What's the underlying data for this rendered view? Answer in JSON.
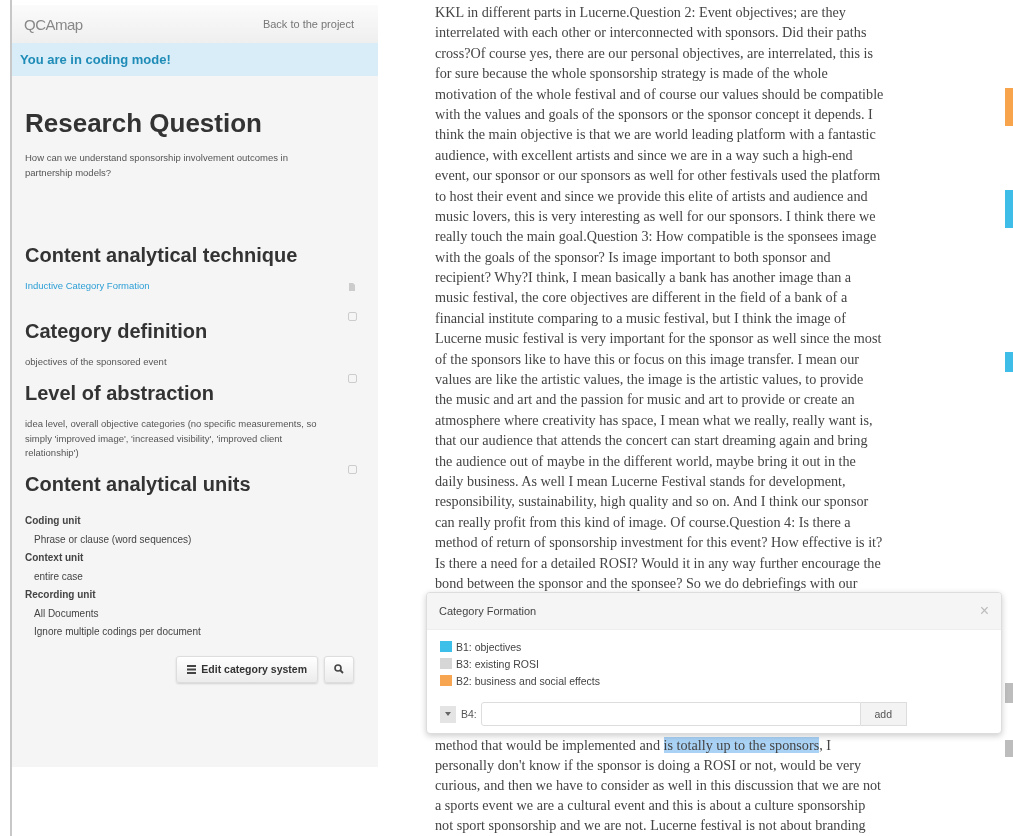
{
  "sidebar": {
    "logo": "QCAmap",
    "back_link": "Back to the project",
    "mode_banner": "You are in coding mode!",
    "sections": [
      {
        "kind": "question",
        "heading": "Research Question",
        "text": "How can we understand sponsorship involvement outcomes in partnership models?"
      },
      {
        "kind": "link",
        "heading": "Content analytical technique",
        "text": "Inductive Category Formation"
      },
      {
        "kind": "text",
        "heading": "Category definition",
        "text": "objectives of the sponsored event"
      },
      {
        "kind": "text",
        "heading": "Level of abstraction",
        "text": "idea level, overall objective categories (no specific measurements, so simply 'improved image', 'increased visibility', 'improved client relationship')"
      },
      {
        "kind": "units",
        "heading": "Content analytical units",
        "units": [
          {
            "label": "Coding unit",
            "values": [
              "Phrase or clause (word sequences)"
            ]
          },
          {
            "label": "Context unit",
            "values": [
              "entire case"
            ]
          },
          {
            "label": "Recording unit",
            "values": [
              "All Documents",
              "Ignore multiple codings per document"
            ]
          }
        ]
      }
    ],
    "buttons": [
      "Edit category system"
    ]
  },
  "document": {
    "lines_before": [
      "KKL in different parts in Lucerne.Question 2: Event objectives; are they",
      "interrelated with each other or interconnected with sponsors. Did their paths",
      "cross?Of course yes, there are our personal objectives, are interrelated, this is",
      "for sure because the whole sponsorship strategy is made of the whole",
      "motivation of the whole festival and of course our values should be compatible",
      "with the values and goals of the sponsors or the sponsor concept it depends. I",
      "think the main objective is that we are world leading platform with a fantastic",
      "audience, with excellent artists and since we are in a way such a high-end",
      "event, our sponsor or our sponsors as well for other festivals used the platform",
      "to host their event and since we provide this elite of artists and audience and",
      "music lovers, this is very interesting as well for our sponsors. I think there we",
      "really touch the main goal.Question 3: How compatible is the sponsees image",
      "with the goals of the sponsor? Is image important to both sponsor and",
      "recipient? Why?I think, I mean basically a bank has another image than a",
      "music festival, the core objectives are different in the field of a bank of a",
      "financial institute comparing to a music festival, but I think the image of",
      "Lucerne music festival is very important for the sponsor as well since the most",
      "of the sponsors like to have this or focus on this image transfer. I mean our",
      "values are like the artistic values, the image is the artistic values, to provide",
      "the music and art and the passion for music and art to provide or create an",
      "atmosphere where creativity has space, I mean what we really, really want is,",
      "that our audience that attends the concert can start dreaming again and bring",
      "the audience out of maybe in the different world, maybe bring it out in the",
      "daily business. As well I mean Lucerne Festival stands for development,",
      "responsibility, sustainability, high quality and so on. And I think our sponsor",
      "can really profit from this kind of image. Of course.Question 4: Is there a",
      "method of return of sponsorship investment for this event? How effective is it?",
      "Is there a need for a detailed ROSI? Would it in any way further encourage the",
      "bond between the sponsor and the sponsee? So we do debriefings with our"
    ],
    "lines_after": [
      [
        {
          "text": "method that would be implemented and ",
          "highlighted": false
        },
        {
          "text": "is totally up to the sponsors",
          "highlighted": true
        },
        {
          "text": ", I",
          "highlighted": false
        }
      ],
      [
        {
          "text": "personally don't know if the sponsor is doing a ROSI or not, would be very",
          "highlighted": false
        }
      ],
      [
        {
          "text": "curious, and then we have to consider as well in this discussion that we are not",
          "highlighted": false
        }
      ],
      [
        {
          "text": "a sports event we are a cultural event and this is about a culture sponsorship",
          "highlighted": false
        }
      ],
      [
        {
          "text": "not sport sponsorship and we are not. Lucerne festival is not about branding",
          "highlighted": false
        }
      ]
    ],
    "margin_marks": [
      {
        "color": "#f7a44c"
      },
      {
        "color": "#3dbde8"
      },
      {
        "color": "#3dbde8"
      },
      {
        "color": "#bdbdbd"
      },
      {
        "color": "#bdbdbd"
      }
    ]
  },
  "popup": {
    "title": "Category Formation",
    "close": "×",
    "categories": [
      {
        "label": "B1: objectives",
        "color": "#3cc0ea"
      },
      {
        "label": "B3: existing ROSI",
        "color": "#d6d6d6"
      },
      {
        "label": "B2: business and social effects",
        "color": "#f8a552"
      }
    ],
    "new_label": "B4:",
    "add_button": "add"
  }
}
